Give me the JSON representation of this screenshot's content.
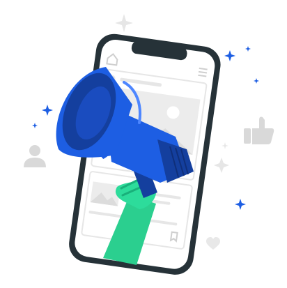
{
  "illustration": {
    "subject": "megaphone-phone-social-promotion",
    "colors": {
      "phone_frame": "#263238",
      "screen": "#ffffff",
      "screen_lines": "#e6e6e6",
      "placeholder": "#ebebeb",
      "megaphone_blue": "#1d5ee3",
      "megaphone_dark": "#143f9e",
      "hand_green": "#2ddc9b",
      "sleeve_green": "#2bcf8f",
      "sparkle_blue": "#1d5ee3",
      "sparkle_grey": "#e4e4e4",
      "icon_grey": "#d9d9d9",
      "heart_blue": "#1d5ee3"
    },
    "icons": [
      "home-icon",
      "menu-icon",
      "heart-icon",
      "comment-icon",
      "bookmark-icon",
      "thumbs-up-icon",
      "user-icon",
      "heart-outline-icon",
      "star-sparkle-icon"
    ]
  }
}
